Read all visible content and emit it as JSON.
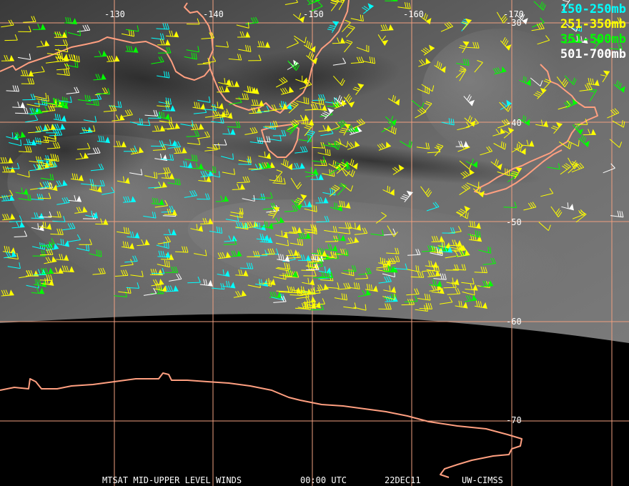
{
  "map": {
    "grid": {
      "longitude_labels": [
        "-130",
        "-140",
        "-150",
        "-160",
        "-170"
      ],
      "latitude_labels": [
        "-30",
        "-40",
        "-50",
        "-60",
        "-70"
      ],
      "line_color": "#f0a080"
    },
    "colors": {
      "coastline": "#ff9f80",
      "cloud_bright": "#9a9a9a",
      "cloud_dark": "#2a2a2a",
      "space": "#000000"
    },
    "legend": [
      {
        "label": "150-250mb",
        "color": "#00ffff"
      },
      {
        "label": "251-350mb",
        "color": "#ffff00"
      },
      {
        "label": "351-500mb",
        "color": "#00ff00"
      },
      {
        "label": "501-700mb",
        "color": "#ffffff"
      }
    ],
    "footer": {
      "product": "MTSAT MID-UPPER LEVEL WINDS",
      "time": "00:00 UTC",
      "date": "22DEC11",
      "source": "UW-CIMSS"
    }
  }
}
